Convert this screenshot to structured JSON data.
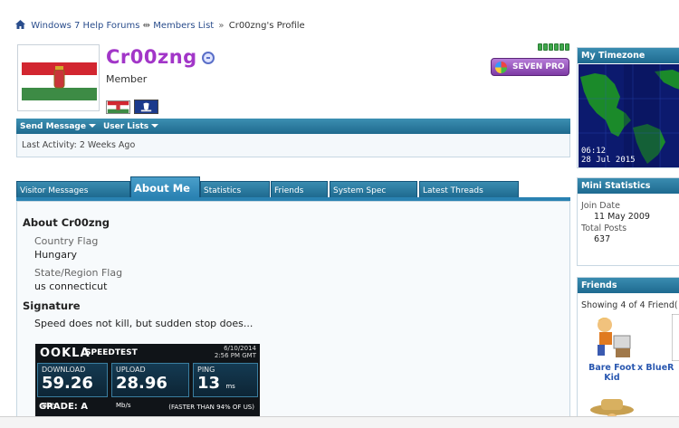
{
  "breadcrumb": {
    "forum": "Windows 7 Help Forums",
    "members": "Members List",
    "profile": "Cr00zng's Profile",
    "sep": "»"
  },
  "profile": {
    "username": "Cr00zng",
    "usertitle": "Member",
    "badge": "SEVEN PRO"
  },
  "actions": {
    "send_message": "Send Message",
    "user_lists": "User Lists",
    "last_activity": "Last Activity: 2 Weeks Ago"
  },
  "tabs": [
    {
      "label": "Visitor Messages"
    },
    {
      "label": "About Me"
    },
    {
      "label": "Statistics"
    },
    {
      "label": "Friends"
    },
    {
      "label": "System Spec"
    },
    {
      "label": "Latest Threads"
    }
  ],
  "about": {
    "title": "About Cr00zng",
    "country_label": "Country Flag",
    "country_value": "Hungary",
    "state_label": "State/Region Flag",
    "state_value": "us connecticut",
    "signature_title": "Signature",
    "signature_text": "Speed does not kill, but sudden stop does..."
  },
  "speedtest": {
    "logo": "OOKLA",
    "brand": "SPEEDTEST",
    "date": "6/10/2014",
    "time": "2:56 PM GMT",
    "download_label": "DOWNLOAD",
    "download_value": "59.26",
    "download_unit": "Mb/s",
    "upload_label": "UPLOAD",
    "upload_value": "28.96",
    "upload_unit": "Mb/s",
    "ping_label": "PING",
    "ping_value": "13",
    "ping_unit": "ms",
    "grade": "GRADE: A",
    "faster": "(FASTER THAN 94% OF US)"
  },
  "sidebar": {
    "timezone_title": "My Timezone",
    "clock_time": "06:12",
    "clock_date": "28 Jul 2015",
    "mini_title": "Mini Statistics",
    "join_label": "Join Date",
    "join_value": "11 May 2009",
    "posts_label": "Total Posts",
    "posts_value": "637",
    "friends_title": "Friends",
    "friends_showing": "Showing 4 of 4 Friend(",
    "friend1": "Bare Foot Kid",
    "friend2": "x BlueR"
  },
  "colors": {
    "username": "#a236c8",
    "header_blue": "#1e6a90",
    "link": "#2a4d8c"
  }
}
